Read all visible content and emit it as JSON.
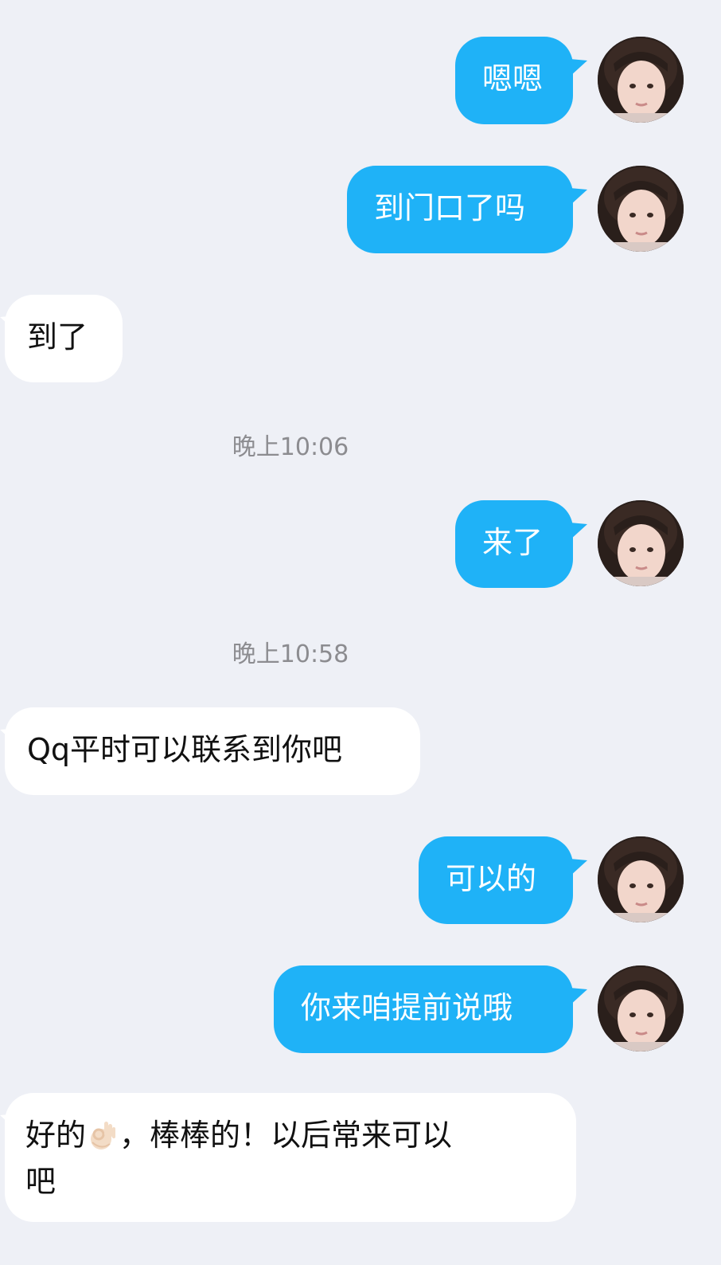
{
  "messages": [
    {
      "type": "sent",
      "text": "嗯嗯"
    },
    {
      "type": "sent",
      "text": "到门口了吗"
    },
    {
      "type": "received",
      "text": "到了"
    },
    {
      "type": "time",
      "text": "晚上10:06"
    },
    {
      "type": "sent",
      "text": "来了"
    },
    {
      "type": "time",
      "text": "晚上10:58"
    },
    {
      "type": "received",
      "text": "Qq平时可以联系到你吧"
    },
    {
      "type": "sent",
      "text": "可以的"
    },
    {
      "type": "sent",
      "text": "你来咱提前说哦"
    },
    {
      "type": "received",
      "text_before_emoji": "好的",
      "emoji": "ok-hand-emoji",
      "text_after_emoji": "，棒棒的！以后常来可以",
      "text_line2": "吧"
    }
  ],
  "colors": {
    "background": "#eef0f6",
    "sent_bubble": "#1fb2f7",
    "received_bubble": "#ffffff",
    "timestamp": "#8c8c90"
  }
}
